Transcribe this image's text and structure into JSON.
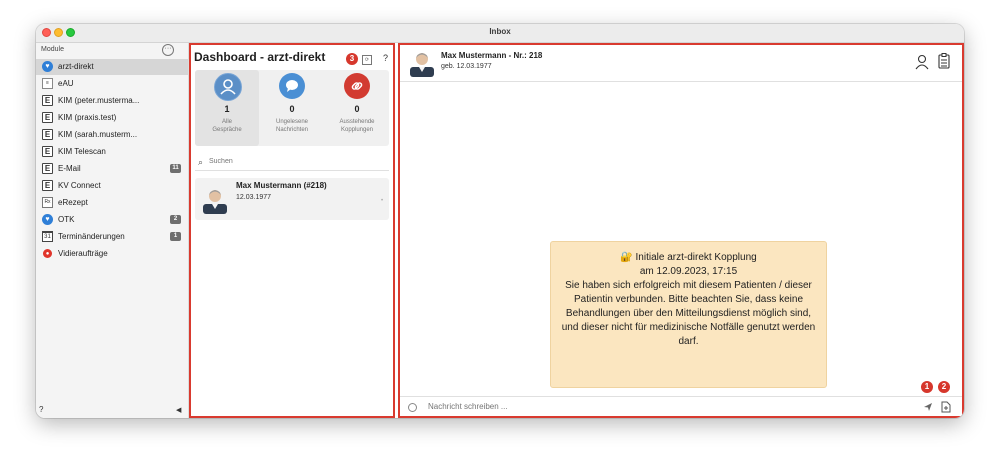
{
  "window": {
    "title": "Inbox"
  },
  "sidebar": {
    "header": "Module",
    "more_icon": "ellipsis-circle-icon",
    "items": [
      {
        "label": "arzt-direkt",
        "icon": "heart-shield-icon",
        "selected": true
      },
      {
        "label": "eAU",
        "icon": "document-icon"
      },
      {
        "label": "KIM (peter.musterma...",
        "icon": "e-letter-icon"
      },
      {
        "label": "KIM (praxis.test)",
        "icon": "e-letter-icon"
      },
      {
        "label": "KIM (sarah.musterm...",
        "icon": "e-letter-icon"
      },
      {
        "label": "KIM Telescan",
        "icon": "e-letter-icon"
      },
      {
        "label": "E-Mail",
        "icon": "e-letter-icon",
        "badge": "11"
      },
      {
        "label": "KV Connect",
        "icon": "e-letter-icon"
      },
      {
        "label": "eRezept",
        "icon": "prescription-icon"
      },
      {
        "label": "OTK",
        "icon": "heart-shield-icon",
        "badge": "2"
      },
      {
        "label": "Terminänderungen",
        "icon": "calendar-icon",
        "badge": "1"
      },
      {
        "label": "Vidieraufträge",
        "icon": "video-icon"
      }
    ],
    "footer_help": "?",
    "footer_collapse": "◀"
  },
  "dashboard": {
    "title": "Dashboard - arzt-direkt",
    "badge": "3",
    "help": "?",
    "stats": [
      {
        "count": "1",
        "label_line1": "Alle",
        "label_line2": "Gespräche",
        "color": "#5b8fc7",
        "icon": "person-icon",
        "selected": true
      },
      {
        "count": "0",
        "label_line1": "Ungelesene",
        "label_line2": "Nachrichten",
        "color": "#4a8fd4",
        "icon": "chat-bubble-icon"
      },
      {
        "count": "0",
        "label_line1": "Ausstehende",
        "label_line2": "Kopplungen",
        "color": "#d23b31",
        "icon": "link-icon"
      }
    ],
    "search_placeholder": "Suchen",
    "conversations": [
      {
        "name": "Max Mustermann (#218)",
        "date": "12.03.1977"
      }
    ]
  },
  "chat": {
    "patient_name": "Max Mustermann - Nr.: 218",
    "patient_dob": "geb. 12.03.1977",
    "system_message": {
      "icon": "🔐",
      "title": "Initiale arzt-direkt Kopplung",
      "datetime": "am 12.09.2023, 17:15",
      "body": "Sie haben sich erfolgreich mit diesem Patienten / dieser Patientin verbunden. Bitte beachten Sie, dass keine Behandlungen über den Mitteilungsdienst möglich sind, und dieser nicht für medizinische Notfälle genutzt werden darf."
    },
    "badges": [
      "1",
      "2"
    ],
    "input_placeholder": "Nachricht schreiben ..."
  },
  "colors": {
    "highlight_border": "#d93a2f",
    "badge_red": "#d6372c",
    "system_message_bg": "#fbe6c0"
  }
}
